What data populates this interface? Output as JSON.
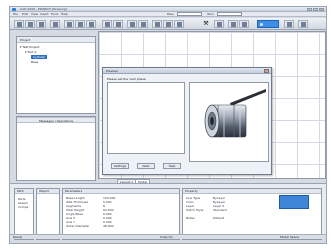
{
  "window": {
    "title": "CAD 2009 - PROJECT [Drawing]"
  },
  "menu": {
    "items": [
      "File",
      "Edit",
      "View",
      "Insert",
      "Tools",
      "Help"
    ]
  },
  "toolbar": {
    "combo1_label": "Pass",
    "combo2_label": "Item",
    "search_label": "Search",
    "clock_text": "0:00"
  },
  "tree": {
    "header": "Project",
    "nodes": [
      "Test Project",
      "Part A",
      "Cylinder",
      "Base"
    ],
    "selected": "Cylinder"
  },
  "left_lower": {
    "caption": "Messages / Operations"
  },
  "dialog": {
    "title": "Preview",
    "prompt": "Please set the next phase",
    "buttons": [
      "Settings",
      "Next",
      "Help"
    ]
  },
  "tabs": [
    "Layout 1",
    "Model"
  ],
  "bottom": {
    "panel1_head": "Path",
    "panel1_items": [
      "Parts",
      "Assem",
      "Comps"
    ],
    "panel2_head": "Object",
    "panel3_head": "Parameters",
    "panel3_lines": [
      "Base Length",
      "Wall Thickness",
      "Segments",
      "Total Height",
      "Angle Base",
      "Axis X",
      "Axis Y",
      "Outer Diameter"
    ],
    "panel3_values": [
      "120.000",
      "5.000",
      "8",
      "64.500",
      "0.000",
      "0.000",
      "0.000",
      "48.000"
    ],
    "panel4_head": "Property",
    "panel4_lines": [
      "Line Type",
      "Color",
      "Layer",
      "Hatch Style",
      "Notes"
    ],
    "panel4_values": [
      "ByLayer",
      "ByLayer",
      "Layer 0",
      "Standard",
      "Default"
    ]
  },
  "status": {
    "left": "Ready",
    "mid": "Snap On",
    "right": "Model Space"
  },
  "colors": {
    "accent": "#3c8ee6",
    "selection": "#2f6fc4"
  }
}
